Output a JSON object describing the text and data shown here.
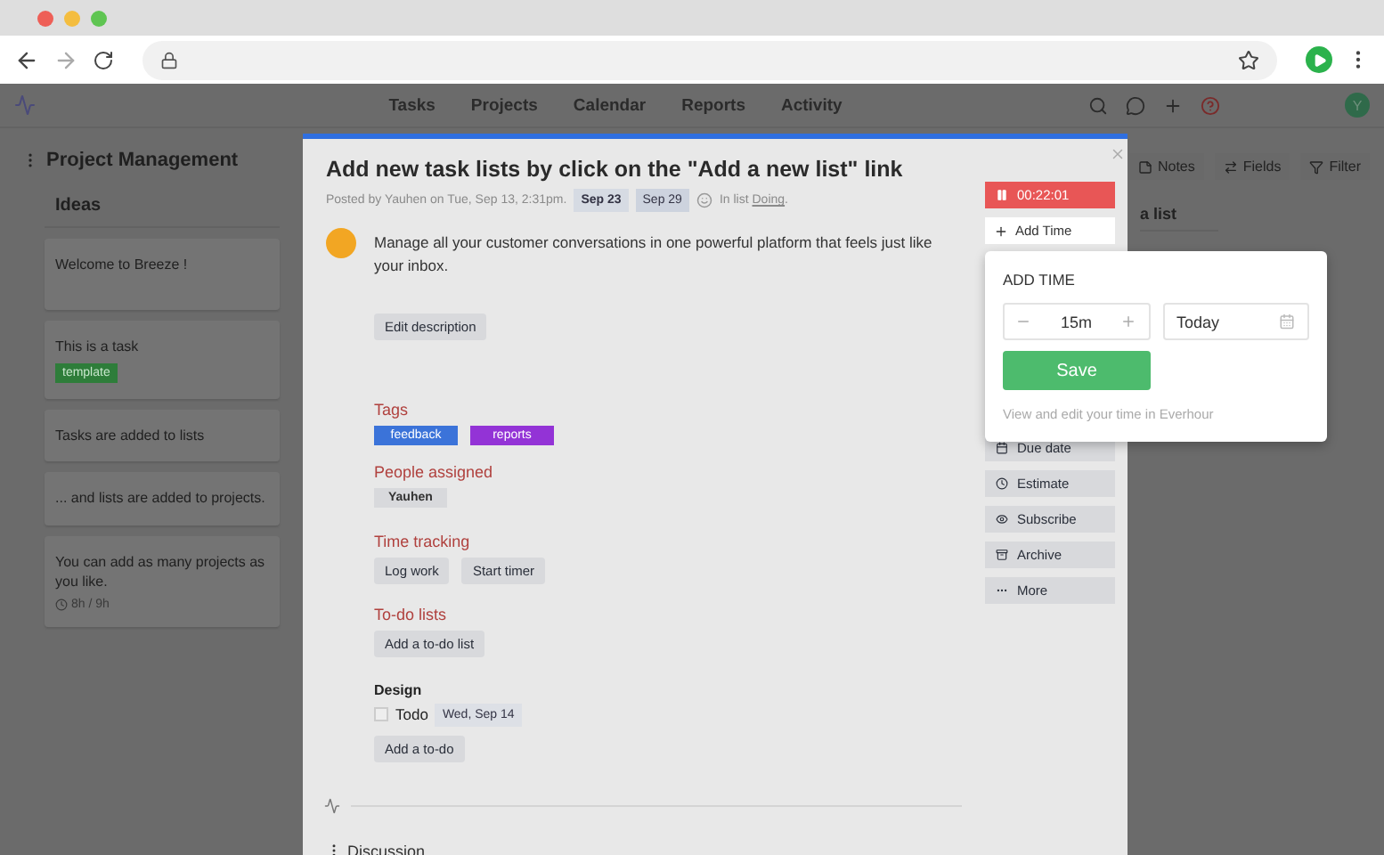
{
  "nav": {
    "items": [
      "Tasks",
      "Projects",
      "Calendar",
      "Reports",
      "Activity"
    ],
    "user_initial": "Y"
  },
  "board": {
    "title": "Project Management",
    "list": {
      "title": "Ideas",
      "cards": [
        {
          "title": "Welcome to Breeze !"
        },
        {
          "title": "This is a task",
          "tag": "template"
        },
        {
          "title": "Tasks are added to lists"
        },
        {
          "title": "... and lists are added to projects."
        },
        {
          "title": "You can add as many projects as you like.",
          "time": "8h / 9h"
        }
      ]
    },
    "toolbar": [
      "Notes",
      "Fields",
      "Filter"
    ],
    "add_list": "a list"
  },
  "task": {
    "title": "Add new task lists by click on the \"Add a new list\" link",
    "posted": "Posted by Yauhen on Tue, Sep 13, 2:31pm.",
    "dates": [
      "Sep 23",
      "Sep 29"
    ],
    "list_prefix": "In list",
    "list_name": "Doing",
    "list_suffix": ".",
    "description": "Manage all your customer conversations in one powerful platform that feels just like your inbox.",
    "edit_button": "Edit description",
    "tags_label": "Tags",
    "tags": [
      {
        "label": "feedback",
        "color": "#3b73d9"
      },
      {
        "label": "reports",
        "color": "#9333d6"
      }
    ],
    "people_label": "People assigned",
    "people": [
      "Yauhen"
    ],
    "time_label": "Time tracking",
    "time_buttons": [
      "Log work",
      "Start timer"
    ],
    "todo_label": "To-do lists",
    "add_todo_list": "Add a to-do list",
    "todo_lists": [
      {
        "title": "Design",
        "items": [
          {
            "text": "Todo",
            "date": "Wed, Sep 14",
            "checked": false
          }
        ],
        "add": "Add a to-do"
      }
    ],
    "discussion": "Discussion"
  },
  "sidebar": {
    "timer": "00:22:01",
    "running": true,
    "add_time": "Add Time",
    "actions": [
      "Due date",
      "Estimate",
      "Subscribe",
      "Archive",
      "More"
    ]
  },
  "popover": {
    "title": "ADD TIME",
    "amount": "15m",
    "date": "Today",
    "save": "Save",
    "hint": "View and edit your time in Everhour"
  }
}
